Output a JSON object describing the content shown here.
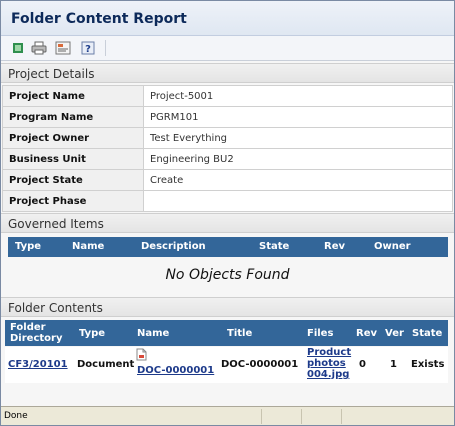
{
  "header": {
    "title": "Folder Content Report"
  },
  "toolbar": {
    "buttons": [
      {
        "icon": "export-icon"
      },
      {
        "icon": "print-icon"
      },
      {
        "icon": "report-icon"
      },
      {
        "icon": "help-icon"
      }
    ]
  },
  "project_details": {
    "heading": "Project Details",
    "rows": [
      {
        "label": "Project Name",
        "value": "Project-5001"
      },
      {
        "label": "Program Name",
        "value": "PGRM101"
      },
      {
        "label": "Project Owner",
        "value": "Test Everything"
      },
      {
        "label": "Business Unit",
        "value": "Engineering BU2"
      },
      {
        "label": "Project State",
        "value": "Create"
      },
      {
        "label": "Project Phase",
        "value": ""
      }
    ]
  },
  "governed_items": {
    "heading": "Governed Items",
    "columns": [
      "Type",
      "Name",
      "Description",
      "State",
      "Rev",
      "Owner"
    ],
    "empty_text": "No Objects Found"
  },
  "folder_contents": {
    "heading": "Folder Contents",
    "columns": {
      "folder_line1": "Folder",
      "folder_line2": "Directory",
      "type": "Type",
      "name": "Name",
      "title": "Title",
      "files": "Files",
      "rev": "Rev",
      "ver": "Ver",
      "state": "State"
    },
    "row": {
      "folder": "CF3/20101",
      "type": "Document",
      "name": "DOC-0000001",
      "title": "DOC-0000001",
      "files_line1": "Product",
      "files_line2": "photos",
      "files_line3": "004.jpg",
      "rev": "0",
      "ver": "1",
      "state": "Exists"
    }
  },
  "status": {
    "text": "Done"
  }
}
